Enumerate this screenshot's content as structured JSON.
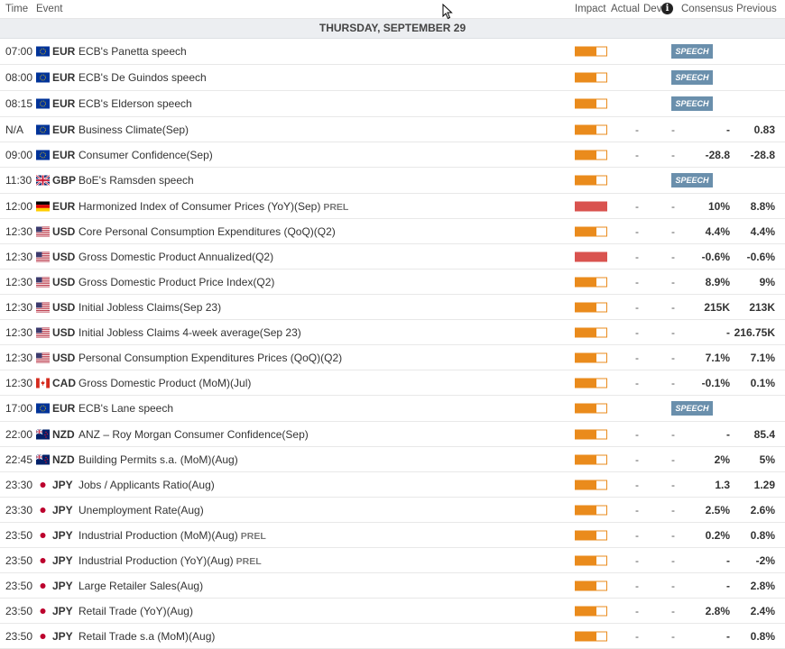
{
  "header": {
    "time": "Time",
    "event": "Event",
    "impact": "Impact",
    "actual": "Actual",
    "dev": "Dev",
    "info_icon": "i",
    "consensus": "Consensus",
    "previous": "Previous"
  },
  "day": "THURSDAY, SEPTEMBER 29",
  "rows": [
    {
      "time": "07:00",
      "flag": "eu",
      "cur": "EUR",
      "event": "ECB's Panetta speech",
      "prel": "",
      "impact": "med",
      "speech": "SPEECH"
    },
    {
      "time": "08:00",
      "flag": "eu",
      "cur": "EUR",
      "event": "ECB's De Guindos speech",
      "prel": "",
      "impact": "med",
      "speech": "SPEECH"
    },
    {
      "time": "08:15",
      "flag": "eu",
      "cur": "EUR",
      "event": "ECB's Elderson speech",
      "prel": "",
      "impact": "med",
      "speech": "SPEECH"
    },
    {
      "time": "N/A",
      "flag": "eu",
      "cur": "EUR",
      "event": "Business Climate(Sep)",
      "prel": "",
      "impact": "med",
      "actual": "-",
      "dev": "-",
      "cons": "-",
      "prev": "0.83"
    },
    {
      "time": "09:00",
      "flag": "eu",
      "cur": "EUR",
      "event": "Consumer Confidence(Sep)",
      "prel": "",
      "impact": "med",
      "actual": "-",
      "dev": "-",
      "cons": "-28.8",
      "prev": "-28.8"
    },
    {
      "time": "11:30",
      "flag": "gb",
      "cur": "GBP",
      "event": "BoE's Ramsden speech",
      "prel": "",
      "impact": "med",
      "speech": "SPEECH"
    },
    {
      "time": "12:00",
      "flag": "de",
      "cur": "EUR",
      "event": "Harmonized Index of Consumer Prices (YoY)(Sep)",
      "prel": "PREL",
      "impact": "high",
      "actual": "-",
      "dev": "-",
      "cons": "10%",
      "prev": "8.8%"
    },
    {
      "time": "12:30",
      "flag": "us",
      "cur": "USD",
      "event": "Core Personal Consumption Expenditures (QoQ)(Q2)",
      "prel": "",
      "impact": "med",
      "actual": "-",
      "dev": "-",
      "cons": "4.4%",
      "prev": "4.4%"
    },
    {
      "time": "12:30",
      "flag": "us",
      "cur": "USD",
      "event": "Gross Domestic Product Annualized(Q2)",
      "prel": "",
      "impact": "high",
      "actual": "-",
      "dev": "-",
      "cons": "-0.6%",
      "prev": "-0.6%"
    },
    {
      "time": "12:30",
      "flag": "us",
      "cur": "USD",
      "event": "Gross Domestic Product Price Index(Q2)",
      "prel": "",
      "impact": "med",
      "actual": "-",
      "dev": "-",
      "cons": "8.9%",
      "prev": "9%"
    },
    {
      "time": "12:30",
      "flag": "us",
      "cur": "USD",
      "event": "Initial Jobless Claims(Sep 23)",
      "prel": "",
      "impact": "med",
      "actual": "-",
      "dev": "-",
      "cons": "215K",
      "prev": "213K"
    },
    {
      "time": "12:30",
      "flag": "us",
      "cur": "USD",
      "event": "Initial Jobless Claims 4-week average(Sep 23)",
      "prel": "",
      "impact": "med",
      "actual": "-",
      "dev": "-",
      "cons": "-",
      "prev": "216.75K"
    },
    {
      "time": "12:30",
      "flag": "us",
      "cur": "USD",
      "event": "Personal Consumption Expenditures Prices (QoQ)(Q2)",
      "prel": "",
      "impact": "med",
      "actual": "-",
      "dev": "-",
      "cons": "7.1%",
      "prev": "7.1%"
    },
    {
      "time": "12:30",
      "flag": "ca",
      "cur": "CAD",
      "event": "Gross Domestic Product (MoM)(Jul)",
      "prel": "",
      "impact": "med",
      "actual": "-",
      "dev": "-",
      "cons": "-0.1%",
      "prev": "0.1%"
    },
    {
      "time": "17:00",
      "flag": "eu",
      "cur": "EUR",
      "event": "ECB's Lane speech",
      "prel": "",
      "impact": "med",
      "speech": "SPEECH"
    },
    {
      "time": "22:00",
      "flag": "nz",
      "cur": "NZD",
      "event": "ANZ – Roy Morgan Consumer Confidence(Sep)",
      "prel": "",
      "impact": "med",
      "actual": "-",
      "dev": "-",
      "cons": "-",
      "prev": "85.4"
    },
    {
      "time": "22:45",
      "flag": "nz",
      "cur": "NZD",
      "event": "Building Permits s.a. (MoM)(Aug)",
      "prel": "",
      "impact": "med",
      "actual": "-",
      "dev": "-",
      "cons": "2%",
      "prev": "5%"
    },
    {
      "time": "23:30",
      "flag": "jp",
      "cur": "JPY",
      "event": "Jobs / Applicants Ratio(Aug)",
      "prel": "",
      "impact": "med",
      "actual": "-",
      "dev": "-",
      "cons": "1.3",
      "prev": "1.29"
    },
    {
      "time": "23:30",
      "flag": "jp",
      "cur": "JPY",
      "event": "Unemployment Rate(Aug)",
      "prel": "",
      "impact": "med",
      "actual": "-",
      "dev": "-",
      "cons": "2.5%",
      "prev": "2.6%"
    },
    {
      "time": "23:50",
      "flag": "jp",
      "cur": "JPY",
      "event": "Industrial Production (MoM)(Aug)",
      "prel": "PREL",
      "impact": "med",
      "actual": "-",
      "dev": "-",
      "cons": "0.2%",
      "prev": "0.8%"
    },
    {
      "time": "23:50",
      "flag": "jp",
      "cur": "JPY",
      "event": "Industrial Production (YoY)(Aug)",
      "prel": "PREL",
      "impact": "med",
      "actual": "-",
      "dev": "-",
      "cons": "-",
      "prev": "-2%"
    },
    {
      "time": "23:50",
      "flag": "jp",
      "cur": "JPY",
      "event": "Large Retailer Sales(Aug)",
      "prel": "",
      "impact": "med",
      "actual": "-",
      "dev": "-",
      "cons": "-",
      "prev": "2.8%"
    },
    {
      "time": "23:50",
      "flag": "jp",
      "cur": "JPY",
      "event": "Retail Trade (YoY)(Aug)",
      "prel": "",
      "impact": "med",
      "actual": "-",
      "dev": "-",
      "cons": "2.8%",
      "prev": "2.4%"
    },
    {
      "time": "23:50",
      "flag": "jp",
      "cur": "JPY",
      "event": "Retail Trade s.a (MoM)(Aug)",
      "prel": "",
      "impact": "med",
      "actual": "-",
      "dev": "-",
      "cons": "-",
      "prev": "0.8%"
    }
  ],
  "colors": {
    "impact_medium": "#ea8b1c",
    "impact_high": "#d9534f",
    "speech_badge": "#6a8fac"
  }
}
